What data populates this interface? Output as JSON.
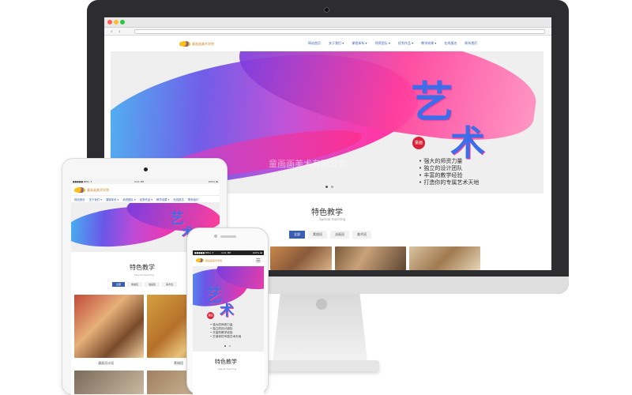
{
  "browser": {
    "dots": [
      "#ff5f57",
      "#ffbd2e",
      "#28c840"
    ],
    "back_arrow": "‹",
    "forward_arrow": "›"
  },
  "site": {
    "logo_text": "童画画美术学院",
    "nav_items": [
      "网站首页",
      "关于我们 ▾",
      "课程体系 ▾",
      "师资团队 ▾",
      "优秀作品 ▾",
      "教学成果 ▾",
      "在线报名",
      "联系我们"
    ],
    "hero": {
      "big_chars": [
        "艺",
        "术"
      ],
      "seal_text": "童画",
      "watermark": "童画画美术有限公司",
      "bullets": [
        "• 强大的师资力量",
        "• 独立的设计团队",
        "• 丰富的教学经验",
        "• 打造你的专属艺术天地"
      ],
      "active_slide": 1,
      "slide_count": 2
    },
    "section": {
      "title": "特色教学",
      "subtitle": "Special teaching",
      "tabs": [
        "全部",
        "素描班",
        "油画班",
        "美术班"
      ],
      "active_tab": 0
    },
    "captions": [
      "漫画设计班",
      "素描班"
    ]
  },
  "tablet": {
    "status_left": "●●●●● BELL ✦",
    "status_time": "4:21 PM",
    "status_right": "100% ▬",
    "nav_items": [
      "网站首页",
      "关于我们 ▾",
      "课程体系 ▾",
      "师资团队 ▾",
      "优秀作品 ▾",
      "教学成果 ▾",
      "在线报名",
      "联系我们"
    ]
  },
  "phone": {
    "status_left": "●●●●● BELL ✦",
    "status_time": "4:21 PM",
    "status_right": "100% ▬",
    "menu_icon": "☰"
  },
  "colors": {
    "accent": "#3a5fb0",
    "brand_orange": "#d08a2c",
    "monitor_frame": "#2d2d2f"
  }
}
